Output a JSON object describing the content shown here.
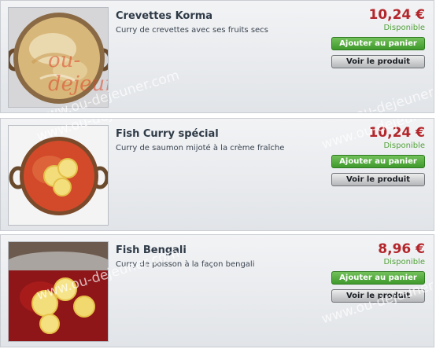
{
  "watermark_text": "www.ou-dejeuner.com",
  "thumb_watermark": "ou-dejeuner.fr",
  "labels": {
    "add_to_cart": "Ajouter au panier",
    "view_product": "Voir le produit"
  },
  "products": [
    {
      "name": "Crevettes Korma",
      "description": "Curry de crevettes avec ses fruits secs",
      "price": "10,24 €",
      "availability": "Disponible",
      "image_icon": "shrimp-korma-dish-icon"
    },
    {
      "name": "Fish Curry spécial",
      "description": "Curry de saumon mijoté à la crème fraîche",
      "price": "10,24 €",
      "availability": "Disponible",
      "image_icon": "salmon-curry-dish-icon"
    },
    {
      "name": "Fish Bengali",
      "description": "Curry de poisson à la façon bengali",
      "price": "8,96 €",
      "availability": "Disponible",
      "image_icon": "bengali-fish-curry-dish-icon"
    }
  ],
  "colors": {
    "price": "#b3262b",
    "availability": "#52a33a",
    "add_button": "#4aa535",
    "view_button": "#c9cacc"
  }
}
